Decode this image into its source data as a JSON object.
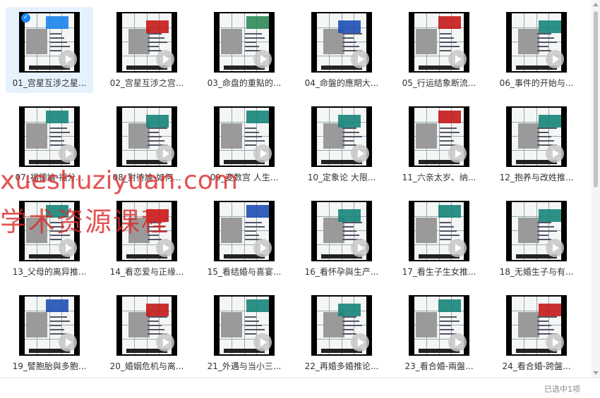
{
  "files": [
    {
      "label": "01_宫星互涉之星...",
      "selected": true,
      "accent": "#1a84ee"
    },
    {
      "label": "02_宫星互涉之宫...",
      "accent": "#c41a1a"
    },
    {
      "label": "03_命盘的重點的...",
      "accent": "#2e8b57"
    },
    {
      "label": "04_命盤的應期大...",
      "accent": "#1f4fb5"
    },
    {
      "label": "05_行运结象断流...",
      "accent": "#c41a1a"
    },
    {
      "label": "06_事件的开始与...",
      "accent": "#16857a"
    },
    {
      "label": "07_福德論-福分...",
      "accent": "#16857a"
    },
    {
      "label": "08_對待論-如何...",
      "accent": "#16857a"
    },
    {
      "label": "09_变数宫 人生...",
      "accent": "#16857a"
    },
    {
      "label": "10_定象论 大限...",
      "accent": "#16857a"
    },
    {
      "label": "11_六亲太岁、纳...",
      "accent": "#c41a1a"
    },
    {
      "label": "12_抱养与改姓推...",
      "accent": "#16857a"
    },
    {
      "label": "13_父母的离异推...",
      "accent": "#16857a"
    },
    {
      "label": "14_看恋爱与正缘...",
      "accent": "#c41a1a"
    },
    {
      "label": "15_看结婚与喜宴...",
      "accent": "#1f4fb5"
    },
    {
      "label": "16_看怀孕與生产...",
      "accent": "#16857a"
    },
    {
      "label": "17_看生子生女推...",
      "accent": "#16857a"
    },
    {
      "label": "18_无婚生子与有...",
      "accent": "#16857a"
    },
    {
      "label": "19_譬胞胎與多胞...",
      "accent": "#1f4fb5"
    },
    {
      "label": "20_婚姻危机与离...",
      "accent": "#c41a1a"
    },
    {
      "label": "21_外遇与当小三...",
      "accent": "#16857a"
    },
    {
      "label": "22_再婚多婚推论...",
      "accent": "#16857a"
    },
    {
      "label": "23_看合婚-兩盤...",
      "accent": "#16857a"
    },
    {
      "label": "24_看合婚-跨盤...",
      "accent": "#c41a1a"
    }
  ],
  "watermark": {
    "line1": "xueshuziyuan.com",
    "line2": "学术资源课程"
  },
  "status": "已选中1项",
  "icons": {
    "play": "play-icon",
    "check": "checkmark-icon"
  }
}
